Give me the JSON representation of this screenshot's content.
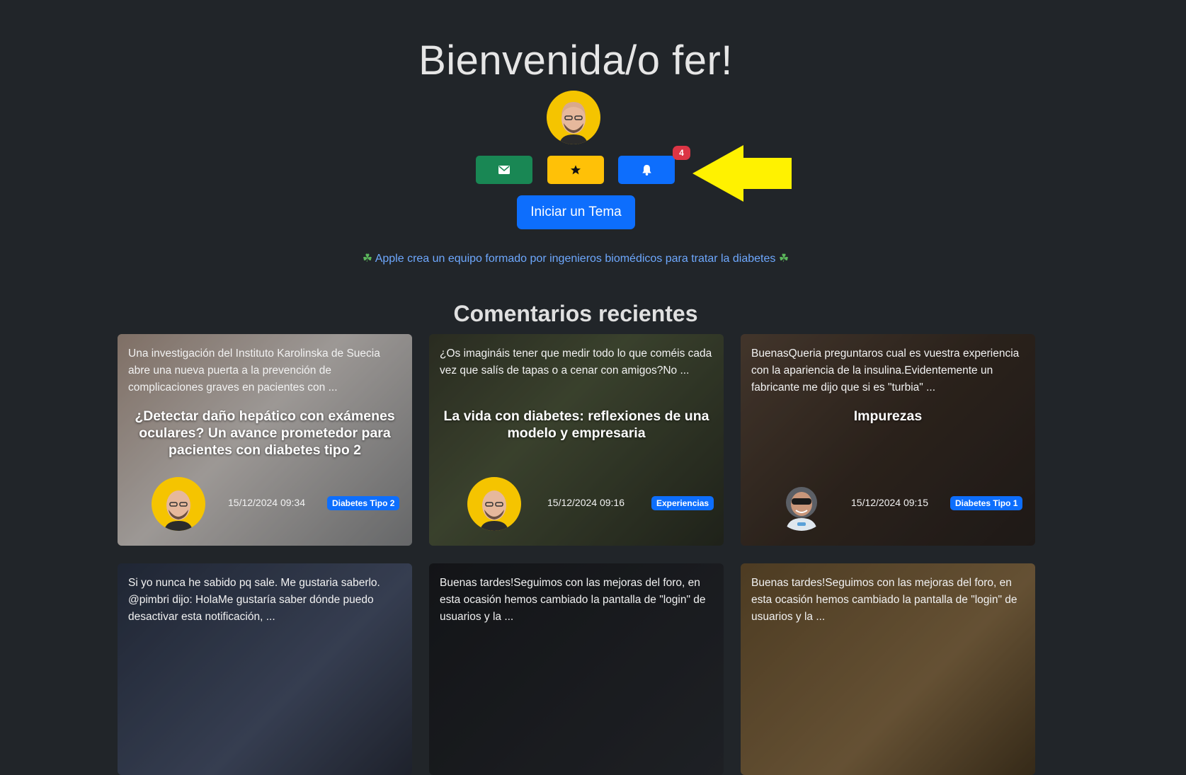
{
  "header": {
    "welcome": "Bienvenida/o fer!",
    "notification_count": "4",
    "start_topic_label": "Iniciar un Tema"
  },
  "news": {
    "clover": "☘",
    "text": "Apple crea un equipo formado por ingenieros biomédicos para tratar la diabetes"
  },
  "section_title": "Comentarios recientes",
  "cards": [
    {
      "excerpt": "Una investigación del Instituto Karolinska de Suecia abre una nueva puerta a la prevención de complicaciones graves en pacientes con ...",
      "title": "¿Detectar daño hepático con exámenes oculares? Un avance prometedor para pacientes con diabetes tipo 2",
      "date": "15/12/2024 09:34",
      "tag": "Diabetes Tipo 2"
    },
    {
      "excerpt": "¿Os imagináis tener que medir todo lo que coméis cada vez que salís de tapas o a cenar con amigos?No ...",
      "title": "La vida con diabetes: reflexiones de una modelo y empresaria",
      "date": "15/12/2024 09:16",
      "tag": "Experiencias"
    },
    {
      "excerpt": "BuenasQueria preguntaros cual es vuestra experiencia con la apariencia de la insulina.Evidentemente un fabricante me dijo que si es \"turbia\" ...",
      "title": "Impurezas",
      "date": "15/12/2024 09:15",
      "tag": "Diabetes Tipo 1"
    },
    {
      "excerpt": "Si yo nunca he sabido pq sale. Me gustaria saberlo. @pimbri dijo: HolaMe gustaría saber dónde puedo desactivar esta notificación, ..."
    },
    {
      "excerpt": "Buenas tardes!Seguimos con las mejoras del foro, en esta ocasión hemos cambiado la pantalla de \"login\" de usuarios y la ..."
    },
    {
      "excerpt": "Buenas tardes!Seguimos con las mejoras del foro, en esta ocasión hemos cambiado la pantalla de \"login\" de usuarios y la ..."
    }
  ],
  "colors": {
    "background": "#212529",
    "mail_button": "#198754",
    "favorites_button": "#ffc107",
    "notifications_button": "#0d6efd",
    "badge": "#dc3545",
    "arrow": "#fff200",
    "link": "#6ea8fe"
  },
  "icons": [
    "envelope-icon",
    "star-icon",
    "bell-icon",
    "clover-icon",
    "arrow-left-icon"
  ]
}
